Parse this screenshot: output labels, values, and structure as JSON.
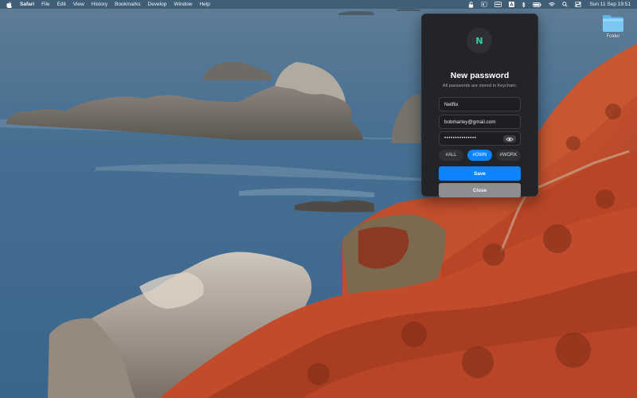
{
  "menubar": {
    "app_name": "Safari",
    "menus": [
      "File",
      "Edit",
      "View",
      "History",
      "Bookmarks",
      "Develop",
      "Window",
      "Help"
    ],
    "clock": "Sun 11 Sep  19:51",
    "status_icons": [
      "lock-open-icon",
      "extension-icon",
      "display-icon",
      "text-input-icon",
      "bluetooth-icon",
      "battery-icon",
      "wifi-icon",
      "search-icon",
      "control-center-icon"
    ]
  },
  "desktop": {
    "folder_label": "Folder"
  },
  "popover": {
    "avatar_letter": "N",
    "title": "New password",
    "subtitle": "All passwords are stored in Keychain.",
    "site_value": "Netflix",
    "email_value": "bobmarley@gmail.com",
    "password_masked": "•••••••••••••••",
    "tags": [
      "#ALL",
      "#OWN",
      "#WORK"
    ],
    "selected_tag": "#OWN",
    "save_label": "Save",
    "close_label": "Close"
  },
  "colors": {
    "accent": "#0a84ff",
    "avatar_letter": "#2fd1a4",
    "popover_bg": "#232427"
  }
}
